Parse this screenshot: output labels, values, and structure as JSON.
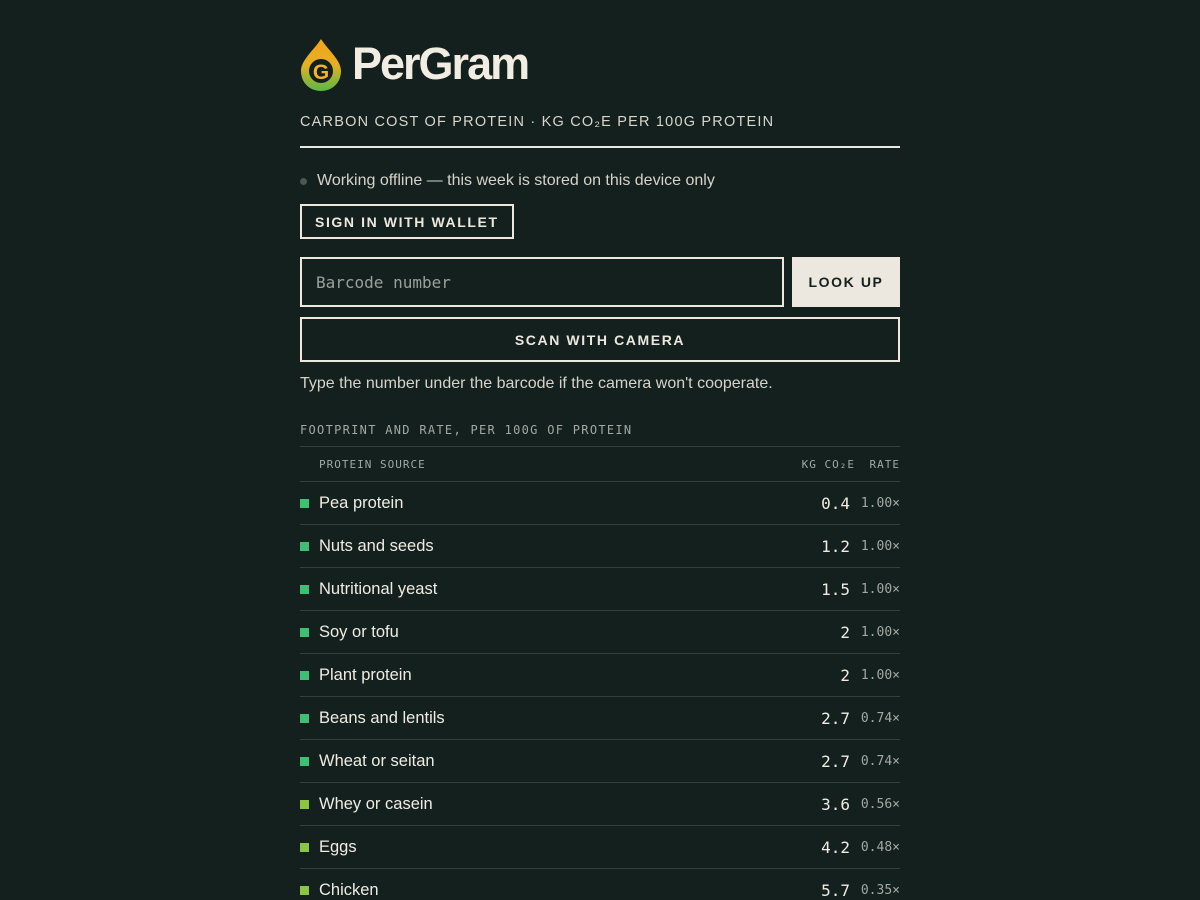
{
  "brand": {
    "name": "PerGram",
    "logo_letter": "G"
  },
  "subtitle": "Carbon cost of protein · kg CO₂e per 100g protein",
  "status": {
    "text": "Working offline — this week is stored on this device only"
  },
  "auth": {
    "wallet_label": "Sign in with wallet"
  },
  "lookup": {
    "placeholder": "Barcode number",
    "button_label": "Look up",
    "scan_label": "Scan with camera",
    "hint": "Type the number under the barcode if the camera won't cooperate."
  },
  "table": {
    "caption": "Footprint and rate, per 100g of protein",
    "headers": {
      "source": "Protein source",
      "kg": "kg CO₂e",
      "rate": "Rate"
    },
    "rows": [
      {
        "name": "Pea protein",
        "kg": "0.4",
        "rate": "1.00×",
        "color": "#3fbf74"
      },
      {
        "name": "Nuts and seeds",
        "kg": "1.2",
        "rate": "1.00×",
        "color": "#3fbf74"
      },
      {
        "name": "Nutritional yeast",
        "kg": "1.5",
        "rate": "1.00×",
        "color": "#3fbf74"
      },
      {
        "name": "Soy or tofu",
        "kg": "2",
        "rate": "1.00×",
        "color": "#3fbf74"
      },
      {
        "name": "Plant protein",
        "kg": "2",
        "rate": "1.00×",
        "color": "#3fbf74"
      },
      {
        "name": "Beans and lentils",
        "kg": "2.7",
        "rate": "0.74×",
        "color": "#3fbf74"
      },
      {
        "name": "Wheat or seitan",
        "kg": "2.7",
        "rate": "0.74×",
        "color": "#3fbf74"
      },
      {
        "name": "Whey or casein",
        "kg": "3.6",
        "rate": "0.56×",
        "color": "#8cc544"
      },
      {
        "name": "Eggs",
        "kg": "4.2",
        "rate": "0.48×",
        "color": "#8cc544"
      },
      {
        "name": "Chicken",
        "kg": "5.7",
        "rate": "0.35×",
        "color": "#8cc544"
      }
    ]
  },
  "colors": {
    "background": "#13201d",
    "foreground": "#ece8df",
    "logo_orange": "#f4a21b",
    "logo_green": "#59b848"
  }
}
